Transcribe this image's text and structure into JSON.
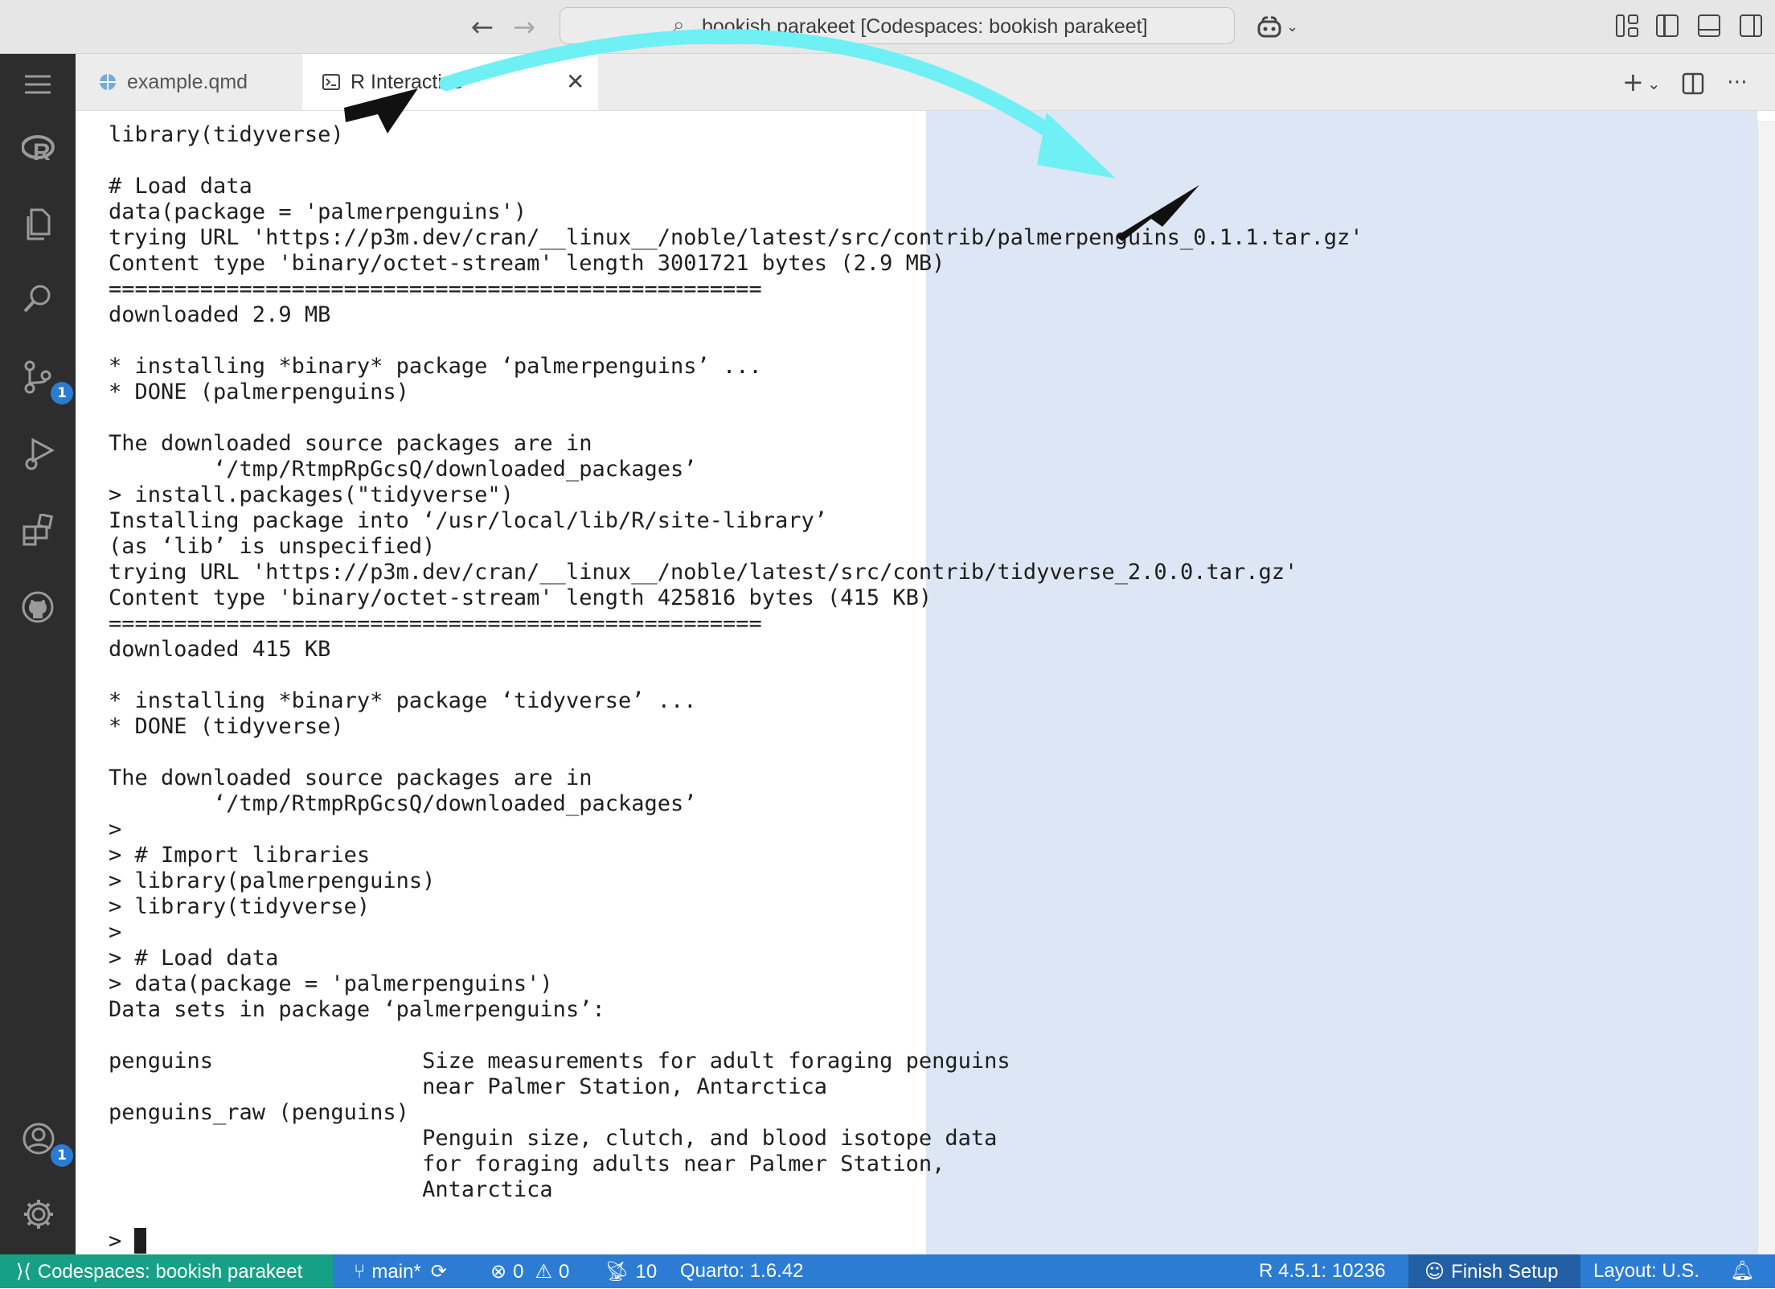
{
  "window": {
    "command_center": "bookish parakeet [Codespaces: bookish parakeet]"
  },
  "icons": {
    "back": "arrow-left-icon",
    "forward": "arrow-right-icon",
    "copilot": "copilot-icon",
    "menu": "hamburger-menu-icon",
    "r": "r-logo-icon",
    "explorer": "files-icon",
    "search": "search-icon",
    "source_control": "source-control-icon",
    "run_debug": "run-debug-icon",
    "extensions": "extensions-icon",
    "github": "github-icon",
    "accounts": "account-icon",
    "settings": "gear-icon"
  },
  "activity_bar": {
    "source_control_badge": "1",
    "accounts_badge": "1"
  },
  "tabs": [
    {
      "label": "example.qmd",
      "active": false
    },
    {
      "label": "R Interactive",
      "active": true
    }
  ],
  "terminal": {
    "lines": [
      "library(tidyverse)",
      "",
      "# Load data",
      "data(package = 'palmerpenguins')",
      "trying URL 'https://p3m.dev/cran/__linux__/noble/latest/src/contrib/palmerpenguins_0.1.1.tar.gz'",
      "Content type 'binary/octet-stream' length 3001721 bytes (2.9 MB)",
      "==================================================",
      "downloaded 2.9 MB",
      "",
      "* installing *binary* package ‘palmerpenguins’ ...",
      "* DONE (palmerpenguins)",
      "",
      "The downloaded source packages are in",
      "        ‘/tmp/RtmpRpGcsQ/downloaded_packages’",
      "> install.packages(\"tidyverse\")",
      "Installing package into ‘/usr/local/lib/R/site-library’",
      "(as ‘lib’ is unspecified)",
      "trying URL 'https://p3m.dev/cran/__linux__/noble/latest/src/contrib/tidyverse_2.0.0.tar.gz'",
      "Content type 'binary/octet-stream' length 425816 bytes (415 KB)",
      "==================================================",
      "downloaded 415 KB",
      "",
      "* installing *binary* package ‘tidyverse’ ...",
      "* DONE (tidyverse)",
      "",
      "The downloaded source packages are in",
      "        ‘/tmp/RtmpRpGcsQ/downloaded_packages’",
      ">",
      "> # Import libraries",
      "> library(palmerpenguins)",
      "> library(tidyverse)",
      ">",
      "> # Load data",
      "> data(package = 'palmerpenguins')",
      "Data sets in package ‘palmerpenguins’:",
      "",
      "penguins                Size measurements for adult foraging penguins",
      "                        near Palmer Station, Antarctica",
      "penguins_raw (penguins)",
      "                        Penguin size, clutch, and blood isotope data",
      "                        for foraging adults near Palmer Station,",
      "                        Antarctica",
      "",
      ">"
    ]
  },
  "status_bar": {
    "remote": "Codespaces: bookish parakeet",
    "branch": "main*",
    "errors": "0",
    "warnings": "0",
    "ports": "10",
    "quarto": "Quarto: 1.6.42",
    "r_session": "R 4.5.1: 10236",
    "finish_setup": "Finish Setup",
    "layout": "Layout: U.S."
  },
  "colors": {
    "status_bar": "#2c7cd4",
    "remote_indicator": "#17a085",
    "annotation_arrow": "#6ef0f5",
    "selection": "#dce6f4"
  }
}
